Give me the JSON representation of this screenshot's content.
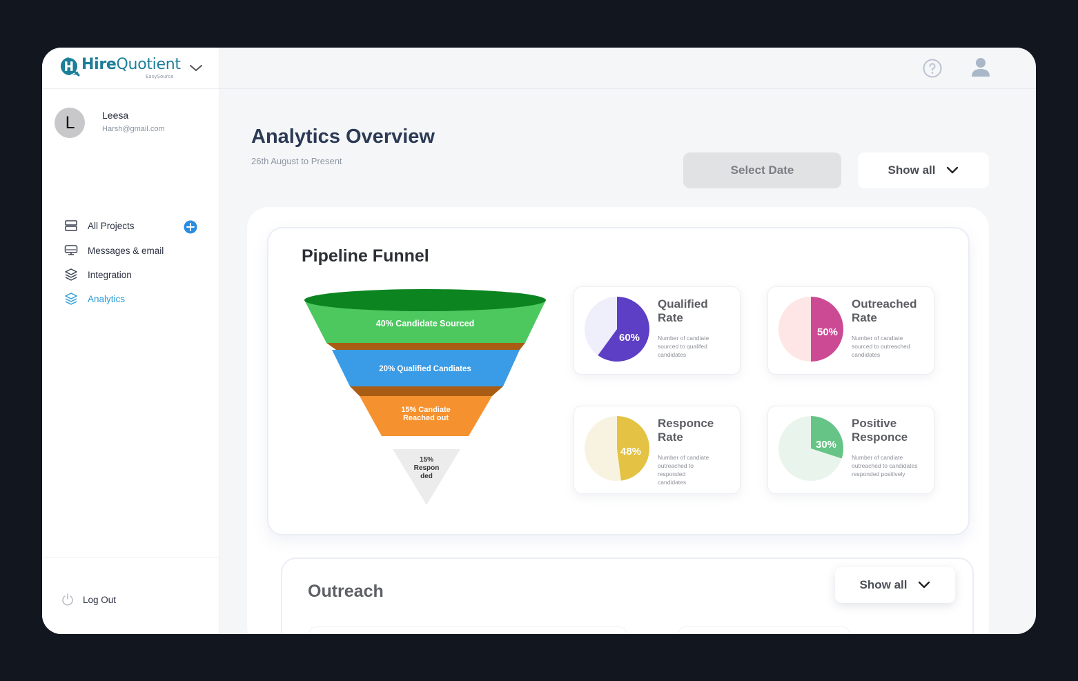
{
  "brand": {
    "name_bold": "Hire",
    "name_light": "Quotient",
    "sub": "EasySource",
    "color": "#1b7f98"
  },
  "user": {
    "initial": "L",
    "name": "Leesa",
    "email": "Harsh@gmail.com"
  },
  "nav": {
    "items": [
      {
        "label": "All Projects",
        "icon": "server-icon"
      },
      {
        "label": "Messages & email",
        "icon": "monitor-icon"
      },
      {
        "label": "Integration",
        "icon": "layers-icon"
      },
      {
        "label": "Analytics",
        "icon": "layers-icon",
        "active": true
      }
    ],
    "logout": "Log Out"
  },
  "header": {
    "title": "Analytics Overview",
    "subtitle": "26th August to Present",
    "select_date": "Select Date",
    "show_all": "Show all"
  },
  "funnel": {
    "title": "Pipeline Funnel",
    "stages": [
      {
        "label": "40% Candidate Sourced",
        "color": "#4cc85f"
      },
      {
        "label": "20% Qualified Candiates",
        "color": "#3a9be6"
      },
      {
        "label_line1": "15% Candiate",
        "label_line2": "Reached out",
        "color": "#f5922f"
      },
      {
        "label_line1": "15%",
        "label_line2": "Respon",
        "label_line3": "ded",
        "color": "#ececec"
      }
    ]
  },
  "stats": [
    {
      "title_line1": "Qualified",
      "title_line2": "Rate",
      "value": 60,
      "value_label": "60%",
      "color": "#5c3fc4",
      "track": "#efeefb",
      "desc": [
        "Number of candiate",
        "sourced to qualifed",
        "candidates"
      ]
    },
    {
      "title_line1": "Outreached",
      "title_line2": "Rate",
      "value": 50,
      "value_label": "50%",
      "color": "#cc4a94",
      "track": "#fde6e5",
      "desc": [
        "Number of candiate",
        "sourced to outreached",
        "candidates"
      ]
    },
    {
      "title_line1": "Responce",
      "title_line2": "Rate",
      "value": 48,
      "value_label": "48%",
      "color": "#e4c344",
      "track": "#f8f3e1",
      "desc": [
        "Number of candiate",
        "outreached to",
        "responded",
        "candidates"
      ]
    },
    {
      "title_line1": "Positive",
      "title_line2": "Responce",
      "value": 30,
      "value_label": "30%",
      "color": "#66c487",
      "track": "#e9f5ec",
      "desc": [
        "Number of candiate",
        "outreached to candidates",
        "responded positively"
      ]
    }
  ],
  "outreach": {
    "title": "Outreach",
    "show_all": "Show all"
  }
}
